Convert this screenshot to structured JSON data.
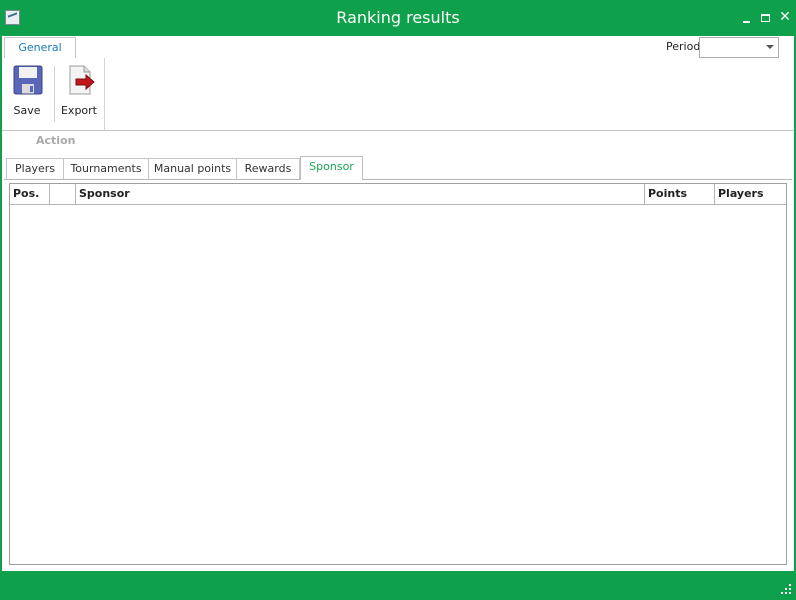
{
  "window": {
    "title": "Ranking results"
  },
  "ribbon": {
    "tab_general": "General",
    "period_label": "Period",
    "period_value": "",
    "buttons": {
      "save": "Save",
      "export": "Export"
    },
    "group_caption": "Action"
  },
  "tabs": [
    "Players",
    "Tournaments",
    "Manual points",
    "Rewards",
    "Sponsor"
  ],
  "active_tab": "Sponsor",
  "grid": {
    "columns": [
      "Pos.",
      "",
      "Sponsor",
      "Points",
      "Players"
    ],
    "rows": []
  },
  "colors": {
    "accent": "#0ea04a",
    "tab_active_text": "#1aa655",
    "ribbon_tab_text": "#1a7ab9"
  }
}
